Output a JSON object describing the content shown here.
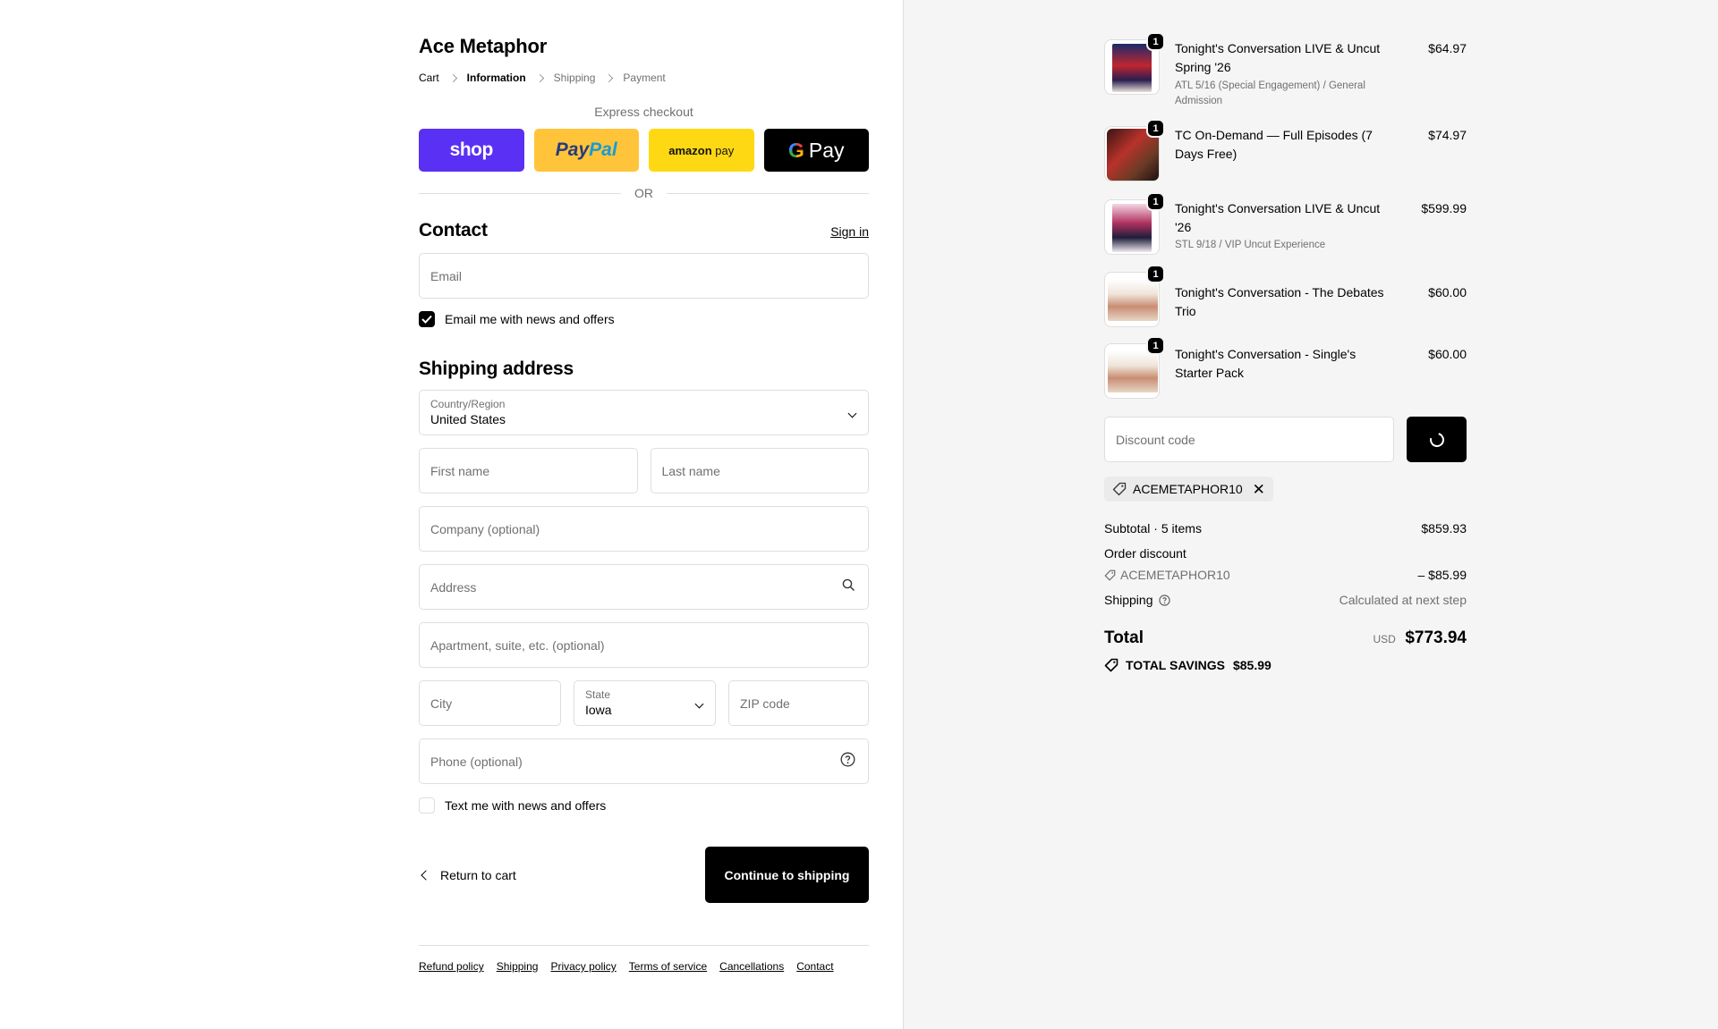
{
  "store": {
    "name": "Ace Metaphor"
  },
  "breadcrumb": [
    "Cart",
    "Information",
    "Shipping",
    "Payment"
  ],
  "express": {
    "label": "Express checkout",
    "buttons": [
      "shop",
      "PayPal",
      "amazon pay",
      "Pay"
    ]
  },
  "or_label": "OR",
  "contact": {
    "title": "Contact",
    "sign_in": "Sign in",
    "email_placeholder": "Email",
    "email_optin": "Email me with news and offers"
  },
  "shipping_address": {
    "title": "Shipping address",
    "country_label": "Country/Region",
    "country_value": "United States",
    "first_name": "First name",
    "last_name": "Last name",
    "company": "Company (optional)",
    "address": "Address",
    "apartment": "Apartment, suite, etc. (optional)",
    "city": "City",
    "state_label": "State",
    "state_value": "Iowa",
    "zip": "ZIP code",
    "phone": "Phone (optional)",
    "sms_optin": "Text me with news and offers"
  },
  "actions": {
    "return": "Return to cart",
    "continue": "Continue to shipping"
  },
  "footer_links": [
    "Refund policy",
    "Shipping",
    "Privacy policy",
    "Terms of service",
    "Cancellations",
    "Contact"
  ],
  "cart_items": [
    {
      "title": "Tonight's Conversation LIVE & Uncut Spring '26",
      "variant": "ATL 5/16 (Special Engagement) / General Admission",
      "price": "$64.97",
      "qty": "1"
    },
    {
      "title": "TC On-Demand — Full Episodes (7 Days Free)",
      "variant": "",
      "price": "$74.97",
      "qty": "1"
    },
    {
      "title": "Tonight's Conversation LIVE & Uncut '26",
      "variant": "STL 9/18 / VIP Uncut Experience",
      "price": "$599.99",
      "qty": "1"
    },
    {
      "title": "Tonight's Conversation - The Debates Trio",
      "variant": "",
      "price": "$60.00",
      "qty": "1"
    },
    {
      "title": "Tonight's Conversation - Single's Starter Pack",
      "variant": "",
      "price": "$60.00",
      "qty": "1"
    }
  ],
  "discount": {
    "placeholder": "Discount code",
    "applied_code": "ACEMETAPHOR10"
  },
  "totals": {
    "subtotal_label": "Subtotal · 5 items",
    "subtotal": "$859.93",
    "order_discount_label": "Order discount",
    "discount_code": "ACEMETAPHOR10",
    "discount_amount": "– $85.99",
    "shipping_label": "Shipping",
    "shipping_value": "Calculated at next step",
    "total_label": "Total",
    "currency": "USD",
    "total": "$773.94",
    "savings_label": "TOTAL SAVINGS",
    "savings_amount": "$85.99"
  },
  "colors": {
    "shop": "#5a31f4",
    "paypal": "#ffc439",
    "amazon": "#ffd814",
    "gpay": "#000000",
    "sidebar_bg": "#f5f5f5"
  }
}
